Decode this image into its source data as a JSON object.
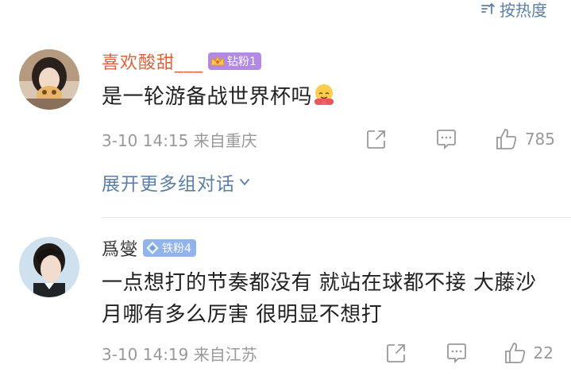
{
  "sort": {
    "label": "按热度"
  },
  "comments": [
    {
      "username": "喜欢酸甜___",
      "username_color": "#e0623a",
      "badge": {
        "label": "钻粉1",
        "color": "#b389e6"
      },
      "text": "是一轮游备战世界杯吗",
      "meta": "3-10 14:15  来自重庆",
      "like_count": "785",
      "expand_label": "展开更多组对话"
    },
    {
      "username": "爲燮",
      "username_color": "#333333",
      "badge": {
        "label": "铁粉4",
        "color": "#8fb3ea"
      },
      "text": "一点想打的节奏都没有 就站在球都不接 大藤沙月哪有多么厉害 很明显不想打",
      "meta": "3-10 14:19  来自江苏",
      "like_count": "22"
    }
  ],
  "colors": {
    "link": "#5b7fa6",
    "meta": "#999999"
  }
}
